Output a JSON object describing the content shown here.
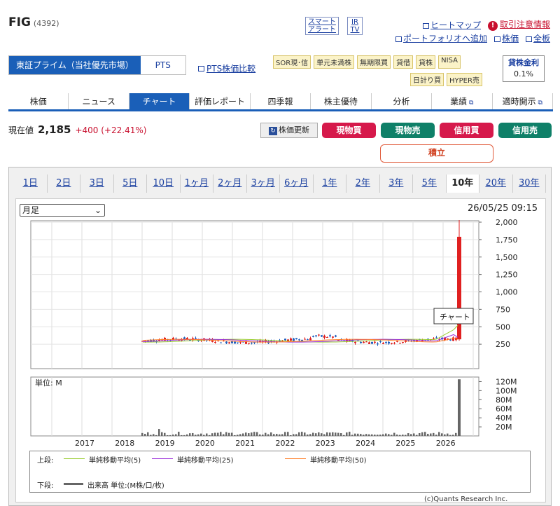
{
  "header": {
    "ticker": "FIG",
    "code": "(4392)",
    "smart_alert": "スマート\nアラート",
    "ir_tv": "IR\nTV",
    "heatmap": "ヒートマップ",
    "warning": "取引注意情報",
    "portfolio": "ポートフォリオへ追加",
    "stock_price": "株価",
    "full_board": "全板"
  },
  "market": {
    "primary": "東証プライム（当社優先市場）",
    "pts": "PTS",
    "pts_compare": "PTS株価比較"
  },
  "tags": [
    "SOR現･信",
    "単元未満株",
    "無期限買",
    "貸借",
    "貸株",
    "NISA",
    "日計り買",
    "HYPER売"
  ],
  "lending": {
    "label": "貸株金利",
    "rate": "0.1%"
  },
  "tabs": [
    "株価",
    "ニュース",
    "チャート",
    "評価レポート",
    "四季報",
    "株主優待",
    "分析",
    "業績",
    "適時開示"
  ],
  "quote": {
    "label": "現在値",
    "price": "2,185",
    "change": "+400 (+22.41%)"
  },
  "actions": {
    "refresh": "株価更新",
    "cash_buy": "現物買",
    "cash_sell": "現物売",
    "margin_buy": "信用買",
    "margin_sell": "信用売",
    "tsumitate": "積立"
  },
  "colors": {
    "accent": "#1a5fb8",
    "buy": "#d6194b",
    "sell": "#0f8068"
  },
  "periods": [
    "1日",
    "2日",
    "3日",
    "5日",
    "10日",
    "1ヶ月",
    "2ヶ月",
    "3ヶ月",
    "6ヶ月",
    "1年",
    "2年",
    "3年",
    "5年",
    "10年",
    "20年",
    "30年"
  ],
  "chart_controls": {
    "interval": "月足",
    "timestamp": "26/05/25 09:15",
    "tooltip": "チャート"
  },
  "chart_data": {
    "type": "line",
    "x": [
      "2017",
      "2018",
      "2019",
      "2020",
      "2021",
      "2022",
      "2023",
      "2024",
      "2025",
      "2026"
    ],
    "price_axis": [
      "2,000",
      "1,750",
      "1,500",
      "1,250",
      "1,000",
      "750",
      "500",
      "250"
    ],
    "volume_axis": [
      "120M",
      "100M",
      "80M",
      "60M",
      "40M",
      "20M"
    ],
    "volume_unit": "単位: M",
    "series": [
      {
        "name": "単純移動平均(5)",
        "color": "#9acd32"
      },
      {
        "name": "単純移動平均(25)",
        "color": "#9b30d9"
      },
      {
        "name": "単純移動平均(50)",
        "color": "#ff7f27"
      }
    ],
    "volume_label": "出来高 単位:(M株/口/枚)",
    "ylim": [
      0,
      2000
    ]
  },
  "legend": {
    "upper": "上段:",
    "lower": "下段:"
  },
  "copyright": "(c)Quants Research Inc."
}
